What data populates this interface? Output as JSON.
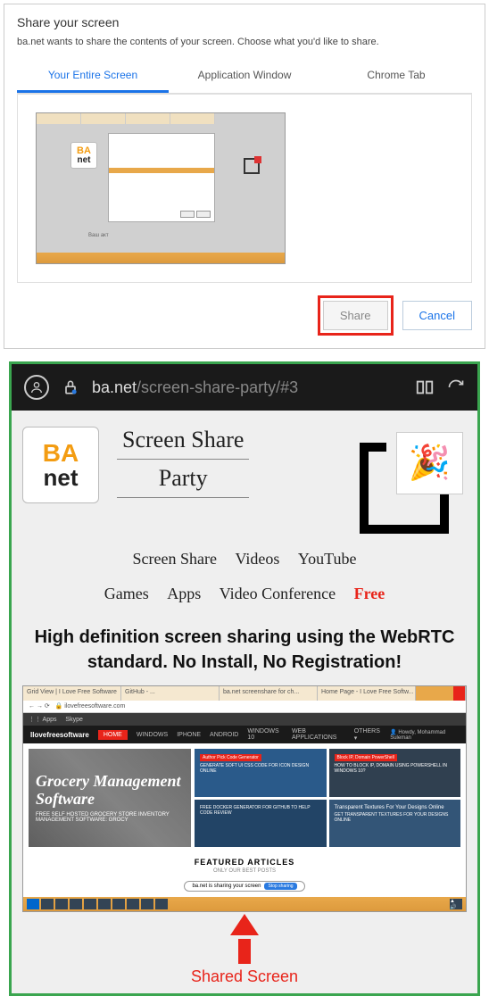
{
  "dialog": {
    "title": "Share your screen",
    "subtitle": "ba.net wants to share the contents of your screen. Choose what you'd like to share.",
    "tabs": {
      "entire": "Your Entire Screen",
      "app": "Application Window",
      "chrome": "Chrome Tab"
    },
    "thumb_caption": "Ваш акт",
    "share": "Share",
    "cancel": "Cancel"
  },
  "browser": {
    "url_host": "ba.net",
    "url_path": "/screen-share-party/#3"
  },
  "page": {
    "logo_top": "BA",
    "logo_bot": "net",
    "title1": "Screen Share",
    "title2": "Party",
    "nav": {
      "a": "Screen Share",
      "b": "Videos",
      "c": "YouTube",
      "d": "Games",
      "e": "Apps",
      "f": "Video Conference",
      "free": "Free"
    },
    "headline": "High definition screen sharing using the WebRTC standard. No Install, No Registration!"
  },
  "shared": {
    "tab1": "Grid View | I Love Free Software",
    "tab2": "GitHub - ...",
    "tab3": "ba.net screenshare for ch...",
    "tab4": "Home Page - I Love Free Softw...",
    "url": "ilovefreesoftware.com",
    "bookmark": "Skype",
    "nav_logo": "Ilovefreesoftware",
    "nav_home": "HOME",
    "nav_items": [
      "WINDOWS",
      "IPHONE",
      "ANDROID",
      "WINDOWS 10",
      "WEB APPLICATIONS",
      "OTHERS ▾"
    ],
    "nav_user": "Howdy, Mohammad Suleman",
    "hero_big": "Grocery Management Software",
    "hero_sm": "FREE SELF HOSTED GROCERY STORE INVENTORY MANAGEMENT SOFTWARE: GROCY",
    "card1_badge": "Author Pick Code Generator",
    "card1": "GENERATE SOFT UI CSS CODE FOR ICON DESIGN ONLINE",
    "card2_badge": "Block IP, Domain PowerShell",
    "card2": "HOW TO BLOCK IP, DOMAIN USING POWERSHELL IN WINDOWS 10?",
    "card3": "FREE DOCKER GENERATOR FOR GITHUB TO HELP CODE REVIEW",
    "card4_t": "Transparent Textures For Your Designs Online",
    "card4": "GET TRANSPARENT TEXTURES FOR YOUR DESIGNS ONLINE",
    "feat_title": "FEATURED ARTICLES",
    "feat_sub": "ONLY OUR BEST POSTS",
    "pill_text": "ba.net is sharing your screen",
    "pill_stop": "Stop sharing"
  },
  "annotation": {
    "label": "Shared Screen"
  }
}
